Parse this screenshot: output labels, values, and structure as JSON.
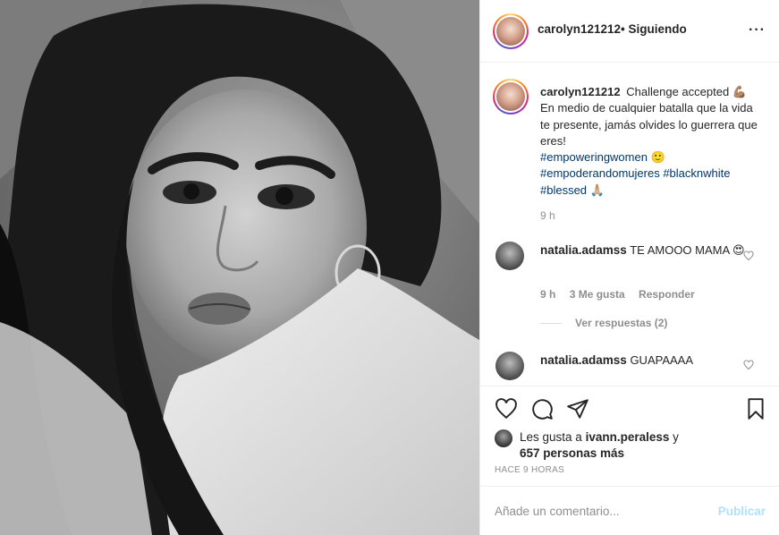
{
  "post": {
    "author": "carolyn121212",
    "follow_status": "• Siguiendo",
    "more_icon": "···"
  },
  "caption": {
    "username": "carolyn121212",
    "line1": "Challenge accepted 💪🏽",
    "line2": "En medio de cualquier batalla que la vida te presente, jamás olvides lo guerrera que eres!",
    "hashtag1": "#empoweringwomen",
    "emoji1": "🙂",
    "hashtag2": "#empoderandomujeres",
    "hashtag3": "#blacknwhite",
    "hashtag4": "#blessed",
    "emoji2": "🙏🏼",
    "time": "9 h"
  },
  "comments": [
    {
      "username": "natalia.adamss",
      "text": "TE AMOOO MAMA 😍",
      "time": "9 h",
      "likes": "3 Me gusta",
      "reply": "Responder",
      "view_replies": "Ver respuestas (2)"
    },
    {
      "username": "natalia.adamss",
      "text": "GUAPAAAA"
    }
  ],
  "likes": {
    "prefix": "Les gusta a",
    "user": "ivann.peraless",
    "conj": "y",
    "others": "657 personas más"
  },
  "timestamp": "HACE 9 HORAS",
  "add_comment": {
    "placeholder": "Añade un comentario...",
    "publish": "Publicar"
  },
  "colors": {
    "hashtag": "#00376b",
    "muted": "#8e8e8e",
    "publish_disabled": "#b2dffc"
  },
  "icons": [
    "heart-icon",
    "comment-icon",
    "share-icon",
    "bookmark-icon",
    "more-icon"
  ]
}
